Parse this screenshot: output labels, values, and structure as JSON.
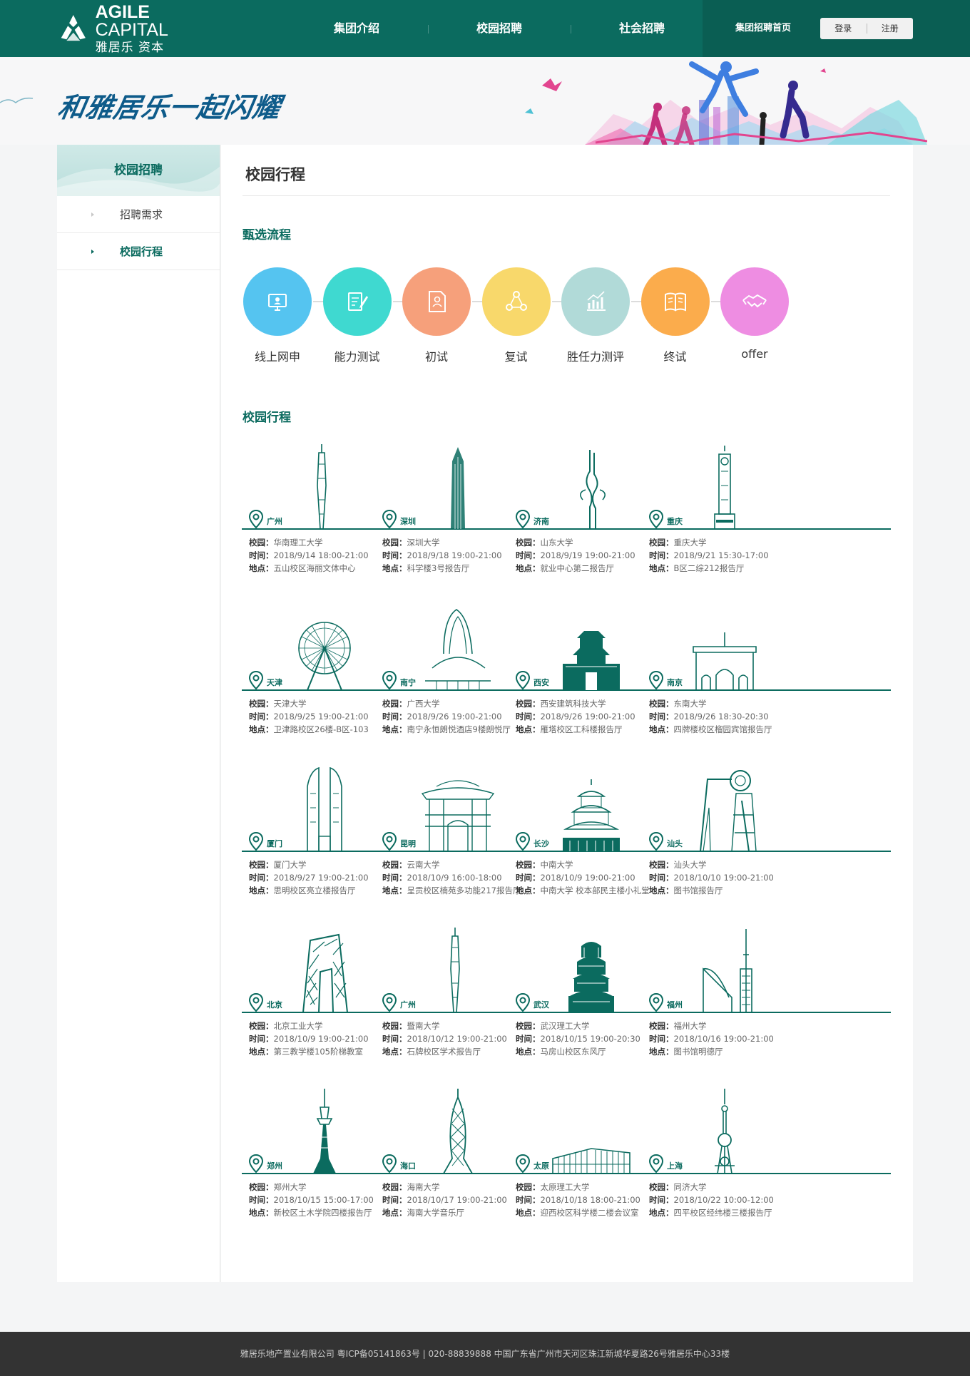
{
  "header": {
    "logo_en_bold": "AGILE",
    "logo_en_light": " CAPITAL",
    "logo_cn": "雅居乐 资本",
    "nav": [
      "集团介绍",
      "校园招聘",
      "社会招聘"
    ],
    "home_link": "集团招聘首页",
    "login": "登录",
    "register": "注册"
  },
  "banner": {
    "slogan": "和雅居乐一起闪耀"
  },
  "sidebar": {
    "title": "校园招聘",
    "items": [
      {
        "label": "招聘需求",
        "active": false
      },
      {
        "label": "校园行程",
        "active": true
      }
    ]
  },
  "main": {
    "page_title": "校园行程",
    "process_title": "甄选流程",
    "campus_title": "校园行程"
  },
  "process": [
    {
      "label": "线上网申",
      "color": "#55c4f0",
      "icon": "monitor-icon"
    },
    {
      "label": "能力测试",
      "color": "#3fd9d0",
      "icon": "pencil-paper-icon"
    },
    {
      "label": "初试",
      "color": "#f6a07b",
      "icon": "resume-icon"
    },
    {
      "label": "复试",
      "color": "#f8d86b",
      "icon": "network-icon"
    },
    {
      "label": "胜任力测评",
      "color": "#b1dad8",
      "icon": "bar-chart-icon"
    },
    {
      "label": "终试",
      "color": "#fbac4c",
      "icon": "book-icon"
    },
    {
      "label": "offer",
      "color": "#ee8de2",
      "icon": "handshake-icon"
    }
  ],
  "campus": {
    "labels": {
      "school": "校园：",
      "time": "时间：",
      "place": "地点："
    },
    "stops": [
      {
        "city": "广州",
        "school": "华南理工大学",
        "time": "2018/9/14 18:00-21:00",
        "place": "五山校区海丽文体中心",
        "landmark": "canton-tower"
      },
      {
        "city": "深圳",
        "school": "深圳大学",
        "time": "2018/9/18 19:00-21:00",
        "place": "科学楼3号报告厅",
        "landmark": "skyscraper"
      },
      {
        "city": "济南",
        "school": "山东大学",
        "time": "2018/9/19 19:00-21:00",
        "place": "就业中心第二报告厅",
        "landmark": "spring-sculpture"
      },
      {
        "city": "重庆",
        "school": "重庆大学",
        "time": "2018/9/21 15:30-17:00",
        "place": "B区二综212报告厅",
        "landmark": "liberation-monument"
      },
      {
        "city": "天津",
        "school": "天津大学",
        "time": "2018/9/25 19:00-21:00",
        "place": "卫津路校区26楼-B区-103",
        "landmark": "ferris-wheel"
      },
      {
        "city": "南宁",
        "school": "广西大学",
        "time": "2018/9/26 19:00-21:00",
        "place": "南宁永恒朗悦酒店9楼朗悦厅",
        "landmark": "convention-center"
      },
      {
        "city": "西安",
        "school": "西安建筑科技大学",
        "time": "2018/9/26 19:00-21:00",
        "place": "雁塔校区工科楼报告厅",
        "landmark": "bell-tower"
      },
      {
        "city": "南京",
        "school": "东南大学",
        "time": "2018/9/26 18:30-20:30",
        "place": "四牌楼校区榴园宾馆报告厅",
        "landmark": "zhongshan-gate"
      },
      {
        "city": "厦门",
        "school": "厦门大学",
        "time": "2018/9/27 19:00-21:00",
        "place": "思明校区亮立楼报告厅",
        "landmark": "twin-towers"
      },
      {
        "city": "昆明",
        "school": "云南大学",
        "time": "2018/10/9 16:00-18:00",
        "place": "呈贡校区楠苑多功能217报告厅",
        "landmark": "memorial-arch"
      },
      {
        "city": "长沙",
        "school": "中南大学",
        "time": "2018/10/9 19:00-21:00",
        "place": "中南大学 校本部民主楼小礼堂",
        "landmark": "pavilion"
      },
      {
        "city": "汕头",
        "school": "汕头大学",
        "time": "2018/10/10 19:00-21:00",
        "place": "图书馆报告厅",
        "landmark": "gate-arch"
      },
      {
        "city": "北京",
        "school": "北京工业大学",
        "time": "2018/10/9 19:00-21:00",
        "place": "第三教学楼105阶梯教室",
        "landmark": "cctv-building"
      },
      {
        "city": "广州",
        "school": "暨南大学",
        "time": "2018/10/12 19:00-21:00",
        "place": "石牌校区学术报告厅",
        "landmark": "canton-tower"
      },
      {
        "city": "武汉",
        "school": "武汉理工大学",
        "time": "2018/10/15 19:00-20:30",
        "place": "马房山校区东风厅",
        "landmark": "yellow-crane-tower"
      },
      {
        "city": "福州",
        "school": "福州大学",
        "time": "2018/10/16 19:00-21:00",
        "place": "图书馆明德厅",
        "landmark": "sail-tower"
      },
      {
        "city": "郑州",
        "school": "郑州大学",
        "time": "2018/10/15 15:00-17:00",
        "place": "新校区土木学院四楼报告厅",
        "landmark": "tv-tower"
      },
      {
        "city": "海口",
        "school": "海南大学",
        "time": "2018/10/17 19:00-21:00",
        "place": "海南大学音乐厅",
        "landmark": "lattice-tower"
      },
      {
        "city": "太原",
        "school": "太原理工大学",
        "time": "2018/10/18 18:00-21:00",
        "place": "迎西校区科学楼二楼会议室",
        "landmark": "exhibition-hall"
      },
      {
        "city": "上海",
        "school": "同济大学",
        "time": "2018/10/22 10:00-12:00",
        "place": "四平校区经纬楼三楼报告厅",
        "landmark": "pearl-tower"
      }
    ]
  },
  "footer": {
    "text": "雅居乐地产置业有限公司 粤ICP备05141863号 | 020-88839888 中国广东省广州市天河区珠江新城华夏路26号雅居乐中心33楼"
  }
}
